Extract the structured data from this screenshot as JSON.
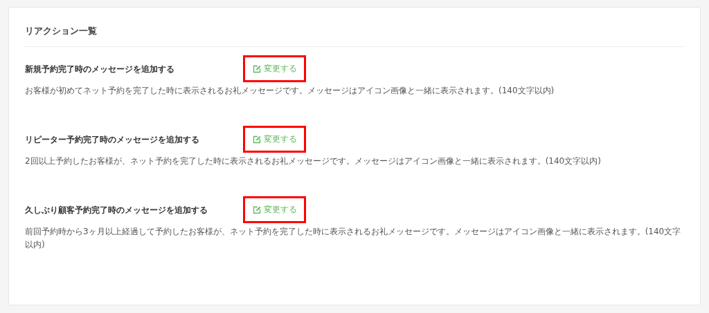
{
  "panel": {
    "title": "リアクション一覧"
  },
  "reactions": [
    {
      "title": "新規予約完了時のメッセージを追加する",
      "edit_label": "変更する",
      "highlighted": true,
      "description": "お客様が初めてネット予約を完了した時に表示されるお礼メッセージです。メッセージはアイコン画像と一緒に表示されます。(140文字以内)"
    },
    {
      "title": "リピーター予約完了時のメッセージを追加する",
      "edit_label": "変更する",
      "highlighted": true,
      "description": "2回以上予約したお客様が、ネット予約を完了した時に表示されるお礼メッセージです。メッセージはアイコン画像と一緒に表示されます。(140文字以内)"
    },
    {
      "title": "久しぶり顧客予約完了時のメッセージを追加する",
      "edit_label": "変更する",
      "highlighted": true,
      "description": "前回予約時から3ヶ月以上経過して予約したお客様が、ネット予約を完了した時に表示されるお礼メッセージです。メッセージはアイコン画像と一緒に表示されます。(140文字以内)"
    }
  ]
}
